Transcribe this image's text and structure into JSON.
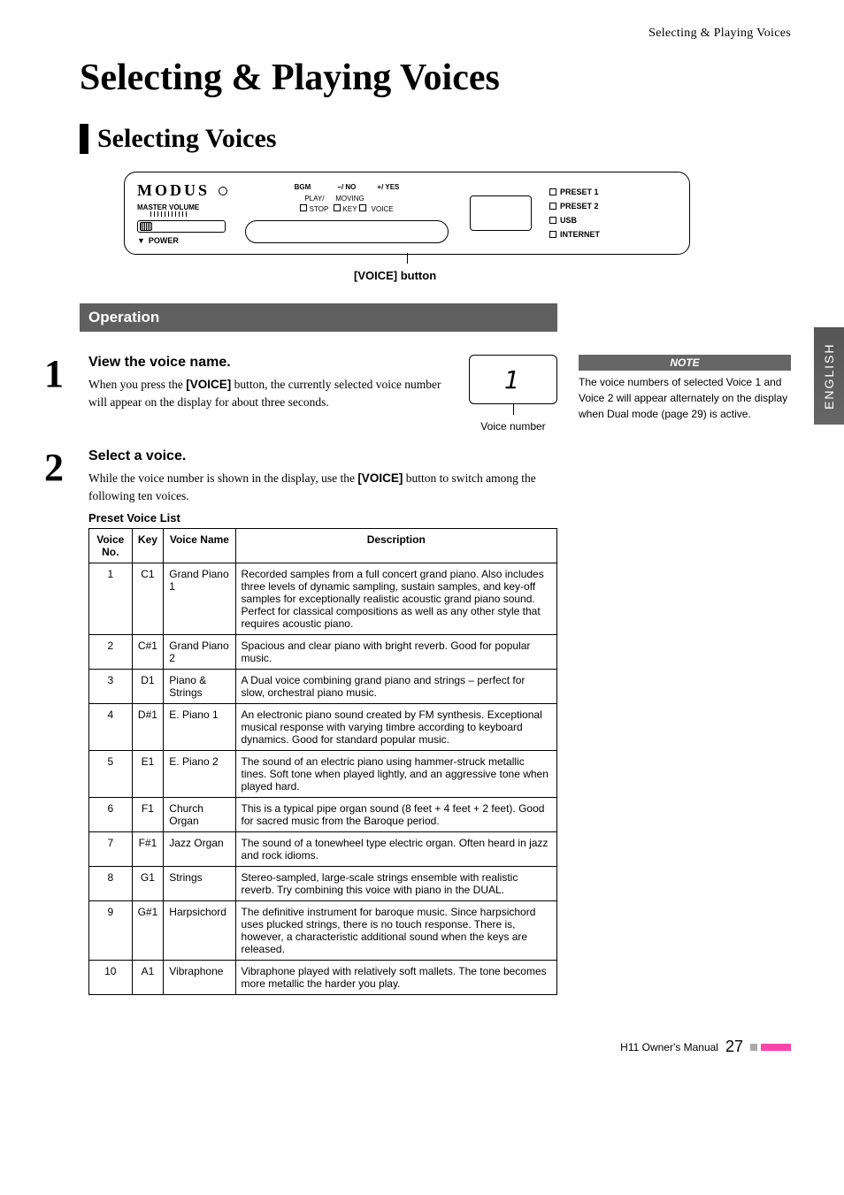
{
  "page_head": "Selecting & Playing Voices",
  "chapter_title": "Selecting & Playing Voices",
  "section_title": "Selecting Voices",
  "panel": {
    "logo": "MODUS",
    "master_volume": "MASTER VOLUME",
    "power": "POWER",
    "top_buttons": [
      "BGM",
      "−/ NO",
      "+/ YES"
    ],
    "bot_buttons": [
      {
        "top": "PLAY/",
        "bot": "STOP"
      },
      {
        "top": "MOVING",
        "bot": "KEY"
      },
      {
        "top": "",
        "bot": "VOICE"
      }
    ],
    "ports": [
      "PRESET 1",
      "PRESET 2",
      "USB",
      "INTERNET"
    ]
  },
  "voice_button_caption": "[VOICE] button",
  "side_tab": "ENGLISH",
  "operation_heading": "Operation",
  "steps": {
    "s1": {
      "num": "1",
      "title": "View the voice name.",
      "text_parts": [
        "When you press the ",
        "[VOICE]",
        " button, the currently selected voice number will appear on the display for about three seconds."
      ]
    },
    "s2": {
      "num": "2",
      "title": "Select a voice.",
      "text_parts": [
        "While the voice number is shown in the display, use the ",
        "[VOICE]",
        " button to switch among the following ten voices."
      ]
    }
  },
  "mini_display": {
    "value": "1",
    "caption": "Voice number"
  },
  "note": {
    "label": "NOTE",
    "text": "The voice numbers of selected Voice 1 and Voice 2 will appear alternately on the display when Dual mode (page 29) is active."
  },
  "table_title": "Preset Voice List",
  "table_headers": {
    "no": "Voice No.",
    "key": "Key",
    "name": "Voice Name",
    "desc": "Description"
  },
  "voices": [
    {
      "no": "1",
      "key": "C1",
      "name": "Grand Piano 1",
      "desc": "Recorded samples from a full concert grand piano. Also includes three levels of dynamic sampling, sustain samples, and key-off samples for exceptionally realistic acoustic grand piano sound. Perfect for classical compositions as well as any other style that requires acoustic piano."
    },
    {
      "no": "2",
      "key": "C#1",
      "name": "Grand Piano 2",
      "desc": "Spacious and clear piano with bright reverb. Good for popular music."
    },
    {
      "no": "3",
      "key": "D1",
      "name": "Piano & Strings",
      "desc": "A Dual voice combining grand piano and strings – perfect for slow, orchestral piano music."
    },
    {
      "no": "4",
      "key": "D#1",
      "name": "E. Piano 1",
      "desc": "An electronic piano sound created by FM synthesis. Exceptional musical response with varying timbre according to keyboard dynamics. Good for standard popular music."
    },
    {
      "no": "5",
      "key": "E1",
      "name": "E. Piano 2",
      "desc": "The sound of an electric piano using hammer-struck metallic tines. Soft tone when played lightly, and an aggressive tone when played hard."
    },
    {
      "no": "6",
      "key": "F1",
      "name": "Church Organ",
      "desc": "This is a typical pipe organ sound (8 feet + 4 feet + 2 feet). Good for sacred music from the Baroque period."
    },
    {
      "no": "7",
      "key": "F#1",
      "name": "Jazz Organ",
      "desc": "The sound of a tonewheel type electric organ. Often heard in jazz and rock idioms."
    },
    {
      "no": "8",
      "key": "G1",
      "name": "Strings",
      "desc": "Stereo-sampled, large-scale strings ensemble with realistic reverb. Try combining this voice with piano in the DUAL."
    },
    {
      "no": "9",
      "key": "G#1",
      "name": "Harpsichord",
      "desc": "The definitive instrument for baroque music. Since harpsichord uses plucked strings, there is no touch response. There is, however, a characteristic additional sound when the keys are released."
    },
    {
      "no": "10",
      "key": "A1",
      "name": "Vibraphone",
      "desc": "Vibraphone played with relatively soft mallets. The tone becomes more metallic the harder you play."
    }
  ],
  "footer": {
    "manual": "H11 Owner's Manual",
    "page": "27"
  }
}
